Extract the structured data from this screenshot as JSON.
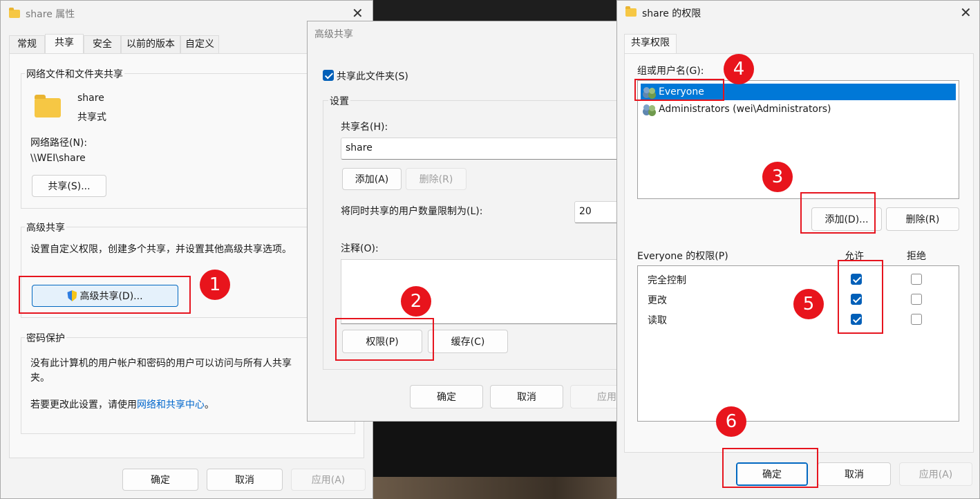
{
  "win1": {
    "title": "share 属性",
    "tabs": [
      "常规",
      "共享",
      "安全",
      "以前的版本",
      "自定义"
    ],
    "net_group": "网络文件和文件夹共享",
    "folder_name": "share",
    "folder_state": "共享式",
    "net_path_label": "网络路径(N):",
    "net_path": "\\\\WEI\\share",
    "share_btn": "共享(S)...",
    "adv_group": "高级共享",
    "adv_desc": "设置自定义权限，创建多个共享，并设置其他高级共享选项。",
    "adv_btn": "高级共享(D)...",
    "pwd_group": "密码保护",
    "pwd_text1": "没有此计算机的用户帐户和密码的用户可以访问与所有人共享",
    "pwd_text2": "夹。",
    "pwd_text3_pre": "若要更改此设置，请使用",
    "pwd_link": "网络和共享中心",
    "pwd_text3_post": "。",
    "ok": "确定",
    "cancel": "取消",
    "apply": "应用(A)"
  },
  "win2": {
    "title": "高级共享",
    "share_chk": "共享此文件夹(S)",
    "settings_group": "设置",
    "share_name_label": "共享名(H):",
    "share_name_value": "share",
    "add_btn": "添加(A)",
    "del_btn": "删除(R)",
    "limit_label": "将同时共享的用户数量限制为(L):",
    "limit_value": "20",
    "comment_label": "注释(O):",
    "perm_btn": "权限(P)",
    "cache_btn": "缓存(C)",
    "ok": "确定",
    "cancel": "取消",
    "apply": "应用"
  },
  "win3": {
    "title": "share 的权限",
    "tab": "共享权限",
    "group_label": "组或用户名(G):",
    "users": [
      "Everyone",
      "Administrators (wei\\Administrators)"
    ],
    "add_btn": "添加(D)...",
    "remove_btn": "删除(R)",
    "perm_label": "Everyone 的权限(P)",
    "allow": "允许",
    "deny": "拒绝",
    "perms": [
      {
        "name": "完全控制",
        "allow": true,
        "deny": false
      },
      {
        "name": "更改",
        "allow": true,
        "deny": false
      },
      {
        "name": "读取",
        "allow": true,
        "deny": false
      }
    ],
    "ok": "确定",
    "cancel": "取消",
    "apply": "应用(A)"
  },
  "badges": [
    "1",
    "2",
    "3",
    "4",
    "5",
    "6"
  ],
  "colors": {
    "annotation_red": "#e6141e",
    "accent": "#005fb8",
    "selection": "#0078d7"
  }
}
